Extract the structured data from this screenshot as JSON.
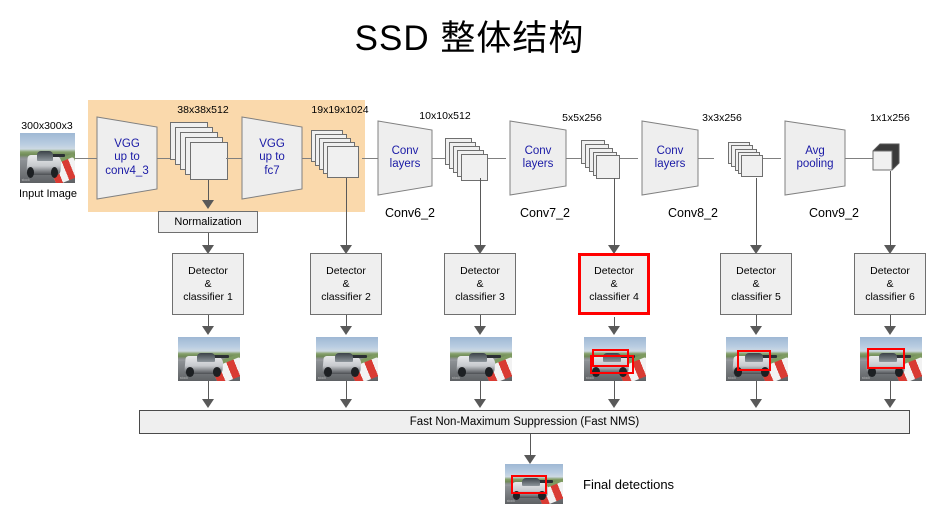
{
  "title": "SSD 整体结构",
  "colors": {
    "vgg_band": "#fad9ac",
    "highlight": "#ff0000",
    "block_fill": "#eeeeee",
    "block_text": "#1a1aa6",
    "connector": "#808080",
    "arrow": "#595959"
  },
  "input": {
    "dim_label": "300x300x3",
    "caption": "Input Image",
    "image_name": "race-car-thumbnail"
  },
  "backbone_blocks": [
    {
      "id": "vgg-conv4-3",
      "lines": [
        "VGG",
        "up to",
        "conv4_3"
      ],
      "shape": "trapezoid"
    },
    {
      "id": "vgg-fc7",
      "lines": [
        "VGG",
        "up to",
        "fc7"
      ],
      "shape": "trapezoid"
    },
    {
      "id": "conv-layers-1",
      "lines": [
        "Conv",
        "layers"
      ],
      "shape": "trapezoid"
    },
    {
      "id": "conv-layers-2",
      "lines": [
        "Conv",
        "layers"
      ],
      "shape": "trapezoid"
    },
    {
      "id": "conv-layers-3",
      "lines": [
        "Conv",
        "layers"
      ],
      "shape": "trapezoid"
    },
    {
      "id": "avg-pooling",
      "lines": [
        "Avg",
        "pooling"
      ],
      "shape": "trapezoid"
    }
  ],
  "feature_maps": [
    {
      "id": "fm-1",
      "dim": "38x38x512",
      "source_name": ""
    },
    {
      "id": "fm-2",
      "dim": "19x19x1024",
      "source_name": ""
    },
    {
      "id": "fm-3",
      "dim": "10x10x512",
      "source_name": "Conv6_2"
    },
    {
      "id": "fm-4",
      "dim": "5x5x256",
      "source_name": "Conv7_2"
    },
    {
      "id": "fm-5",
      "dim": "3x3x256",
      "source_name": "Conv8_2"
    },
    {
      "id": "fm-6",
      "dim": "1x1x256",
      "source_name": "Conv9_2"
    }
  ],
  "normalization": {
    "label": "Normalization"
  },
  "detectors": [
    {
      "line1": "Detector",
      "line2": "&",
      "line3": "classifier 1",
      "highlighted": false
    },
    {
      "line1": "Detector",
      "line2": "&",
      "line3": "classifier 2",
      "highlighted": false
    },
    {
      "line1": "Detector",
      "line2": "&",
      "line3": "classifier 3",
      "highlighted": false
    },
    {
      "line1": "Detector",
      "line2": "&",
      "line3": "classifier 4",
      "highlighted": true
    },
    {
      "line1": "Detector",
      "line2": "&",
      "line3": "classifier 5",
      "highlighted": false
    },
    {
      "line1": "Detector",
      "line2": "&",
      "line3": "classifier 6",
      "highlighted": false
    }
  ],
  "detection_thumbnails": [
    {
      "id": "thumb-1",
      "has_box": false
    },
    {
      "id": "thumb-2",
      "has_box": false
    },
    {
      "id": "thumb-3",
      "has_box": false
    },
    {
      "id": "thumb-4",
      "has_box": true
    },
    {
      "id": "thumb-5",
      "has_box": true
    },
    {
      "id": "thumb-6",
      "has_box": true
    }
  ],
  "nms": {
    "label": "Fast Non-Maximum  Suppression (Fast NMS)"
  },
  "final": {
    "label": "Final detections",
    "image_name": "final-detection-thumbnail"
  }
}
